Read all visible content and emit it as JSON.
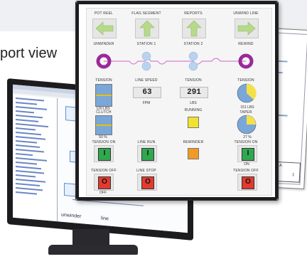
{
  "banner": {
    "text": "port view"
  },
  "colors": {
    "arrow": "#b7d98b",
    "roller": "#9a2a9a",
    "nip": "#b9d3ef",
    "gauge_blue": "#7aa6d8",
    "gauge_yellow": "#f4e14a",
    "green_btn": "#2fa84f",
    "red_btn": "#e33a2e",
    "indicator_yellow": "#f2e230",
    "indicator_orange": "#f29a24"
  },
  "hmi": {
    "top_labels": [
      "POT REEL",
      "FLAG SEGMENT",
      "REPORTS",
      "UNWIND LINE"
    ],
    "arrows": [
      "left-arrow-icon",
      "up-arrow-icon",
      "up-arrow-icon",
      "right-arrow-icon"
    ],
    "roll_labels": [
      "UNWINDER",
      "STATION 1",
      "STATION 2",
      "REWIND"
    ],
    "row3_labels": [
      "TENSION",
      "LINE SPEED",
      "TENSION",
      "TENSION"
    ],
    "values": {
      "line_speed": "63",
      "tension_center": "291"
    },
    "units": {
      "fpm": "FPM",
      "lbs_center": "LBS",
      "lbs_left": "120 LBS",
      "lbs_right": "151 LBS"
    },
    "row4_labels": [
      "CLUTCH",
      "",
      "RUNNING",
      "TAPER"
    ],
    "percent_left": "50 %",
    "percent_right": "27 %",
    "indicator_labels": [
      "TENSION ON",
      "LINE RUN",
      "",
      "TENSION ON"
    ],
    "indicator_extra": [
      "",
      "",
      "REWINDER",
      ""
    ],
    "on_label": "ON",
    "buttons_green": [
      "I",
      "I",
      "I"
    ],
    "red_labels": [
      "TENSION OFF",
      "LINE STOP",
      "",
      "TENSION OFF"
    ],
    "buttons_red": [
      "O",
      "O",
      "O"
    ],
    "off_label": "OFF"
  },
  "monitor": {
    "screen_label": "unwinder",
    "screen_sub": "line"
  },
  "report": {
    "sheet_letter": "A",
    "sheet_no": "1"
  }
}
